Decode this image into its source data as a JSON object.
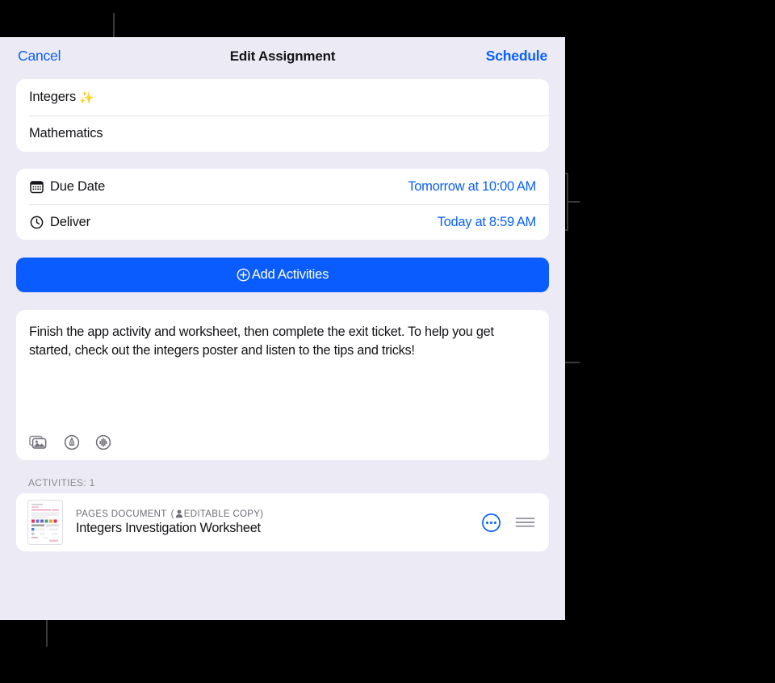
{
  "window": {
    "background_color": "#000000",
    "sheet_background": "#ECEBF5",
    "accent_blue": "#0A60FF",
    "button_blue": "#0A5CFF"
  },
  "navbar": {
    "cancel_label": "Cancel",
    "title": "Edit Assignment",
    "schedule_label": "Schedule"
  },
  "title_card": {
    "assignment_name": "Integers",
    "assignment_emoji": "✨",
    "subject": "Mathematics"
  },
  "date_card": {
    "rows": [
      {
        "icon": "calendar-icon",
        "label": "Due Date",
        "value": "Tomorrow at 10:00 AM"
      },
      {
        "icon": "clock-icon",
        "label": "Deliver",
        "value": "Today at 8:59 AM"
      }
    ]
  },
  "add_activities": {
    "icon": "plus-circle-icon",
    "label": "Add Activities"
  },
  "description": {
    "text": "Finish the app activity and worksheet, then complete the exit ticket. To help you get started, check out the integers poster and listen to the tips and tricks!",
    "tools": [
      {
        "name": "photo-stack-icon"
      },
      {
        "name": "markup-pen-icon"
      },
      {
        "name": "audio-wave-icon"
      }
    ]
  },
  "activities": {
    "section_label": "ACTIVITIES: 1",
    "items": [
      {
        "thumbnail": "pages-document-thumbnail",
        "kicker_type": "PAGES DOCUMENT",
        "kicker_badge_icon": "person-icon",
        "kicker_badge": "( EDITABLE COPY)",
        "title": "Integers Investigation Worksheet",
        "more_icon": "more-ellipsis-circle-icon",
        "drag_icon": "reorder-handle-icon"
      }
    ]
  }
}
